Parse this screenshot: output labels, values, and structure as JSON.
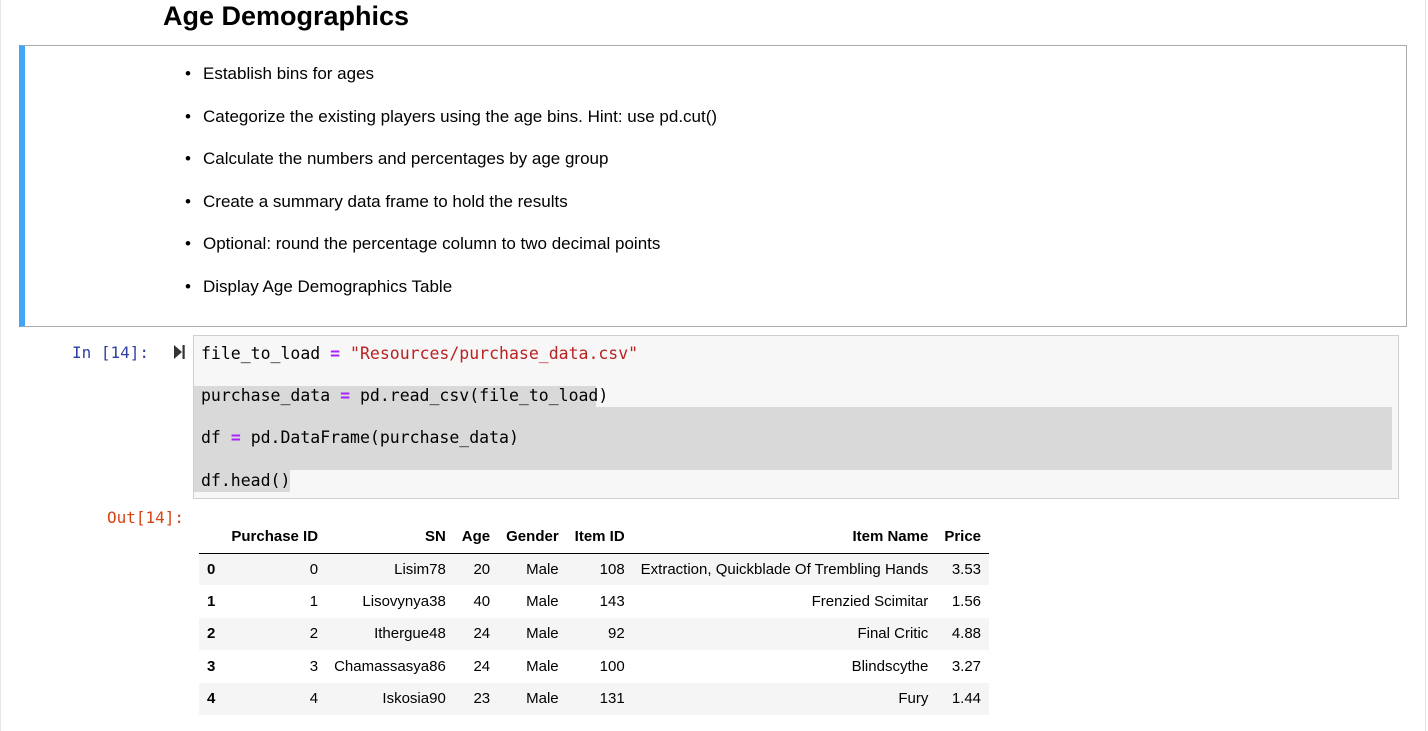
{
  "heading": "Age Demographics",
  "markdown": {
    "items": [
      "Establish bins for ages",
      "Categorize the existing players using the age bins. Hint: use pd.cut()",
      "Calculate the numbers and percentages by age group",
      "Create a summary data frame to hold the results",
      "Optional: round the percentage column to two decimal points",
      "Display Age Demographics Table"
    ],
    "accent_color": "#42a5f5"
  },
  "code_cell": {
    "prompt": "In [14]:",
    "lines": {
      "l1_var": "file_to_load",
      "l1_op": "=",
      "l1_str": "\"Resources/purchase_data.csv\"",
      "l2_var": "purchase_data",
      "l2_op": "=",
      "l2_rest": "pd.read_csv(file_to_load)",
      "l3_var": "df",
      "l3_op": "=",
      "l3_rest": "pd.DataFrame(purchase_data)",
      "l4": "df.head()"
    },
    "run_icon": "run-cell-icon"
  },
  "output": {
    "prompt": "Out[14]:",
    "columns": [
      "",
      "Purchase ID",
      "SN",
      "Age",
      "Gender",
      "Item ID",
      "Item Name",
      "Price"
    ],
    "rows": [
      [
        "0",
        "0",
        "Lisim78",
        "20",
        "Male",
        "108",
        "Extraction, Quickblade Of Trembling Hands",
        "3.53"
      ],
      [
        "1",
        "1",
        "Lisovynya38",
        "40",
        "Male",
        "143",
        "Frenzied Scimitar",
        "1.56"
      ],
      [
        "2",
        "2",
        "Ithergue48",
        "24",
        "Male",
        "92",
        "Final Critic",
        "4.88"
      ],
      [
        "3",
        "3",
        "Chamassasya86",
        "24",
        "Male",
        "100",
        "Blindscythe",
        "3.27"
      ],
      [
        "4",
        "4",
        "Iskosia90",
        "23",
        "Male",
        "131",
        "Fury",
        "1.44"
      ]
    ]
  }
}
